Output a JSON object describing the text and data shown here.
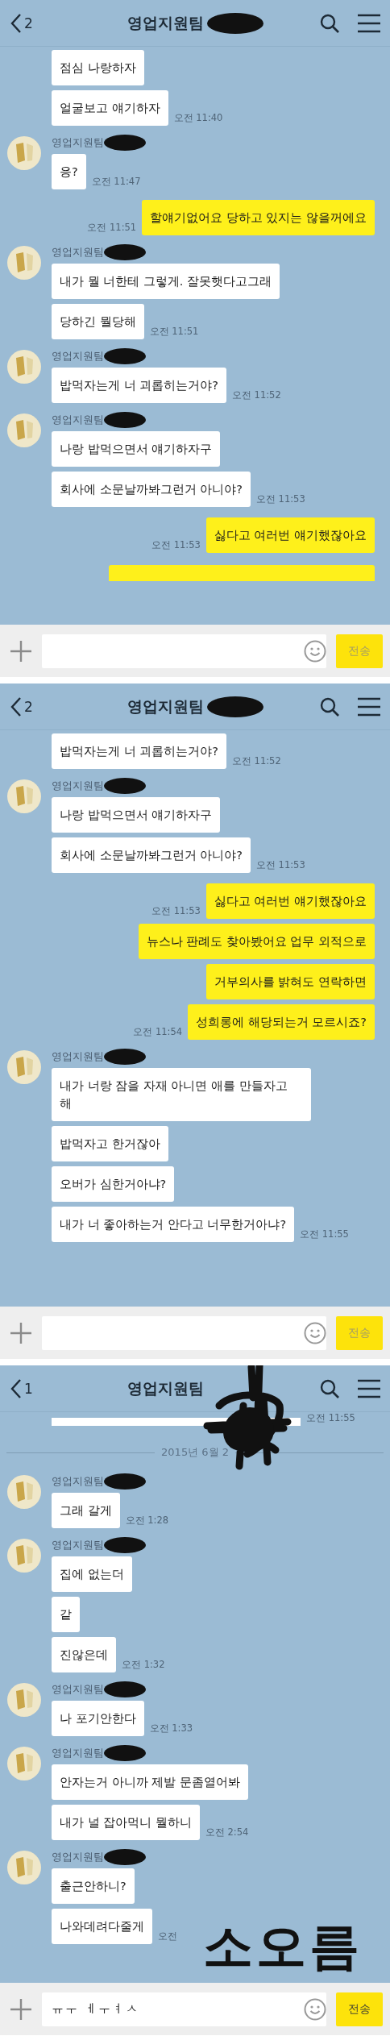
{
  "screens": [
    {
      "header": {
        "back_count": "2",
        "title": "영업지원팀",
        "redacted": true
      },
      "messages": [
        {
          "kind": "received",
          "text": "점심 나랑하자"
        },
        {
          "kind": "received",
          "text": "얼굴보고 얘기하자",
          "time": "오전 11:40"
        },
        {
          "kind": "received",
          "sender": "영업지원팀",
          "text": "응?",
          "time": "오전 11:47"
        },
        {
          "kind": "sent",
          "text": "할얘기없어요 당하고 있지는 않을꺼에요",
          "time": "오전 11:51"
        },
        {
          "kind": "received",
          "sender": "영업지원팀",
          "text": "내가 뭘 너한테 그렇게. 잘못햇다고그래"
        },
        {
          "kind": "received",
          "text": "당하긴 뭘당해",
          "time": "오전 11:51"
        },
        {
          "kind": "received",
          "sender": "영업지원팀",
          "text": "밥먹자는게 너 괴롭히는거야?",
          "time": "오전 11:52"
        },
        {
          "kind": "received",
          "sender": "영업지원팀",
          "text": "나랑 밥먹으면서 얘기하자구"
        },
        {
          "kind": "received",
          "text": "회사에 소문날까봐그런거 아니야?",
          "time": "오전 11:53"
        },
        {
          "kind": "sent",
          "text": "싫다고 여러번 얘기했잖아요",
          "time": "오전 11:53"
        },
        {
          "kind": "cut_sent"
        }
      ],
      "input": {
        "send_label": "전송"
      }
    },
    {
      "header": {
        "back_count": "2",
        "title": "영업지원팀",
        "redacted": true
      },
      "messages": [
        {
          "kind": "received",
          "text": "밥먹자는게 너 괴롭히는거야?",
          "time": "오전 11:52"
        },
        {
          "kind": "received",
          "sender": "영업지원팀",
          "text": "나랑 밥먹으면서 얘기하자구"
        },
        {
          "kind": "received",
          "text": "회사에 소문날까봐그런거 아니야?",
          "time": "오전 11:53"
        },
        {
          "kind": "sent",
          "text": "싫다고 여러번 얘기했잖아요",
          "time": "오전 11:53"
        },
        {
          "kind": "sent",
          "text": "뉴스나 판례도 찾아봤어요 업무 외적으로"
        },
        {
          "kind": "sent",
          "text": "거부의사를 밝혀도 연락하면"
        },
        {
          "kind": "sent",
          "text": "성희롱에 해당되는거 모르시죠?",
          "time": "오전 11:54"
        },
        {
          "kind": "received",
          "sender": "영업지원팀",
          "text": "내가 너랑 잠을 자재 아니면 애를 만들자고 해"
        },
        {
          "kind": "received",
          "text": "밥먹자고 한거잖아"
        },
        {
          "kind": "received",
          "text": "오버가 심한거아냐?"
        },
        {
          "kind": "received",
          "text": "내가 너 좋아하는거 안다고 너무한거아냐?",
          "time": "오전 11:55"
        }
      ],
      "input": {
        "send_label": "전송"
      }
    },
    {
      "header": {
        "back_count": "1",
        "title": "영업지원팀",
        "scribbled": true
      },
      "messages": [
        {
          "kind": "cut_received",
          "time": "오전 11:55"
        },
        {
          "kind": "divider",
          "text": "2015년 6월 2"
        },
        {
          "kind": "received",
          "sender": "영업지원팀",
          "text": "그래 갈게",
          "time": "오전 1:28"
        },
        {
          "kind": "received",
          "sender": "영업지원팀",
          "text": "집에 없는더"
        },
        {
          "kind": "received",
          "text": "같"
        },
        {
          "kind": "received",
          "text": "진않은데",
          "time": "오전 1:32"
        },
        {
          "kind": "received",
          "sender": "영업지원팀",
          "text": "나 포기안한다",
          "time": "오전 1:33"
        },
        {
          "kind": "received",
          "sender": "영업지원팀",
          "text": "안자는거 아니까 제발 문좀열어봐"
        },
        {
          "kind": "received",
          "text": "내가 널 잡아먹니 뭘하니",
          "time": "오전 2:54"
        },
        {
          "kind": "received",
          "sender": "영업지원팀",
          "text": "출근안하니?"
        },
        {
          "kind": "received",
          "text": "나와데려다줄게",
          "time": "오전"
        }
      ],
      "handwritten_note": "소오름",
      "input": {
        "value": "ㅠㅜ ㅔㅜㅕㅅ",
        "send_label": "전송"
      }
    }
  ]
}
